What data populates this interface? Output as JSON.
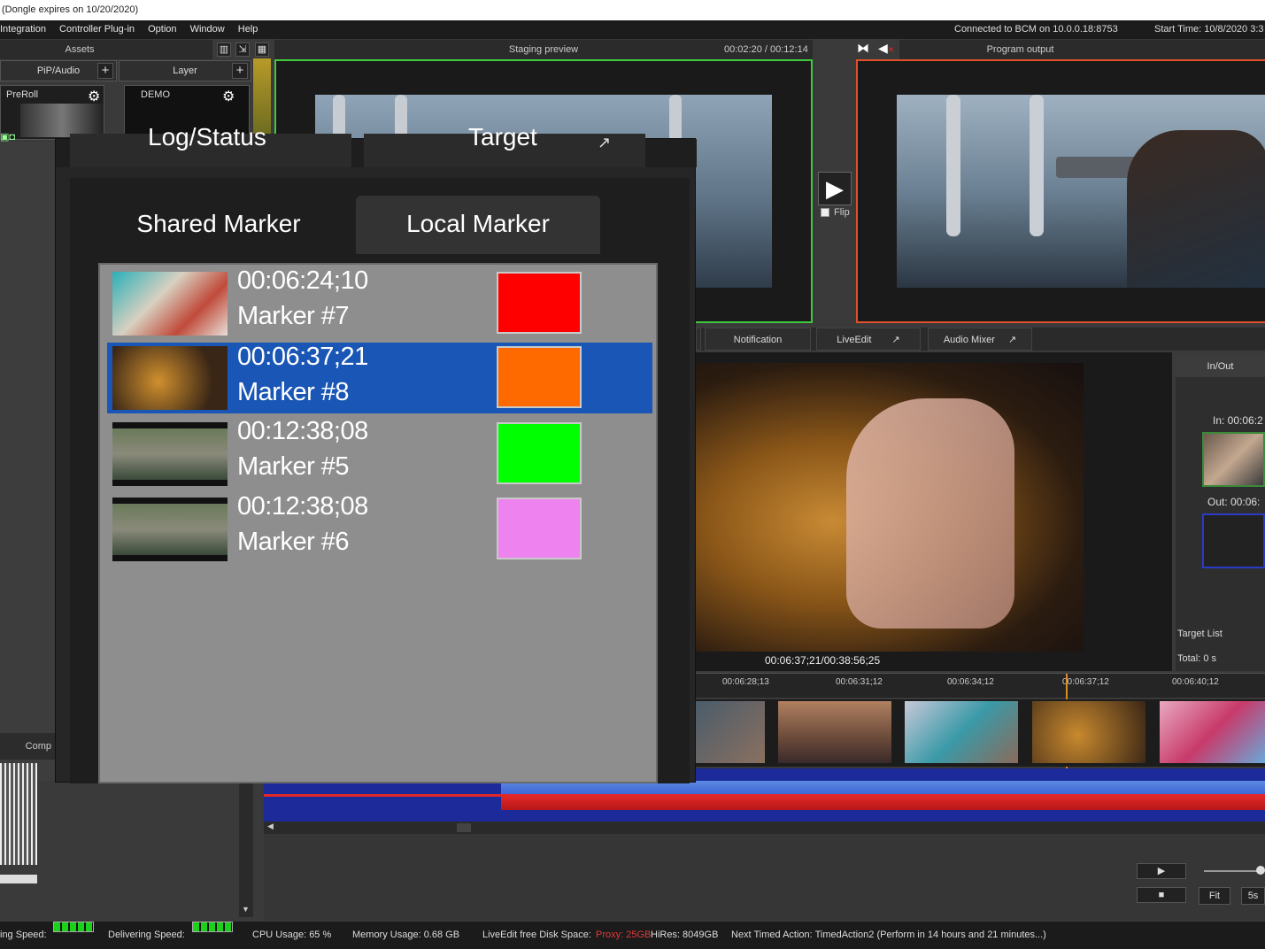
{
  "app": {
    "title": "(Dongle expires on 10/20/2020)"
  },
  "menu": {
    "items": [
      "Integration",
      "Controller Plug-in",
      "Option",
      "Window",
      "Help"
    ],
    "connection": "Connected to BCM on 10.0.0.18:8753",
    "start_time": "Start Time: 10/8/2020 3:3"
  },
  "assets": {
    "header": "Assets",
    "tab_pip_audio": "PiP/Audio",
    "tab_layer": "Layer",
    "preroll_label": "PreRoll",
    "demo_label": "DEMO",
    "comp_label": "Comp"
  },
  "staging": {
    "header": "Staging preview",
    "timecode": "00:02:20 / 00:12:14"
  },
  "program": {
    "header": "Program output"
  },
  "take": {
    "flip_label": "Flip"
  },
  "overlay": {
    "top_tab_left": "Log/Status",
    "top_tab_right": "Target",
    "tab_shared": "Shared Marker",
    "tab_local": "Local Marker",
    "markers": [
      {
        "time": "00:06:24;10",
        "name": "Marker #7",
        "color": "#ff0000"
      },
      {
        "time": "00:06:37;21",
        "name": "Marker #8",
        "color": "#ff6a00"
      },
      {
        "time": "00:12:38;08",
        "name": "Marker #5",
        "color": "#00ff00"
      },
      {
        "time": "00:12:38;08",
        "name": "Marker #6",
        "color": "#ee82ee"
      }
    ],
    "selected_index": 1
  },
  "liveedit": {
    "tabs": [
      "Notification",
      "LiveEdit",
      "Audio Mixer"
    ],
    "clip_timecode": "00:06:37;21/00:38:56;25",
    "inout": {
      "header": "In/Out",
      "in_label": "In: 00:06:2",
      "out_label": "Out: 00:06:",
      "target_list": "Target List",
      "total": "Total: 0 s"
    },
    "ruler": [
      "00:06:28;13",
      "00:06:31;12",
      "00:06:34;12",
      "00:06:37;12",
      "00:06:40;12"
    ],
    "fit_label": "Fit",
    "fives_label": "5s"
  },
  "status": {
    "loading_speed": "ing Speed:",
    "delivering_speed": "Delivering Speed:",
    "cpu": "CPU Usage: 65 %",
    "memory": "Memory Usage: 0.68 GB",
    "disk_label": "LiveEdit free Disk Space:",
    "proxy": "Proxy: 25GB",
    "hires": "HiRes: 8049GB",
    "next_action": "Next Timed Action: TimedAction2 (Perform in 14 hours and 21 minutes...)"
  },
  "colors": {
    "staging_border": "#3ec93e",
    "program_border": "#e0502a",
    "selection": "#1a56b5",
    "audio_blue": "#3f63d6",
    "audio_red": "#e02828"
  }
}
